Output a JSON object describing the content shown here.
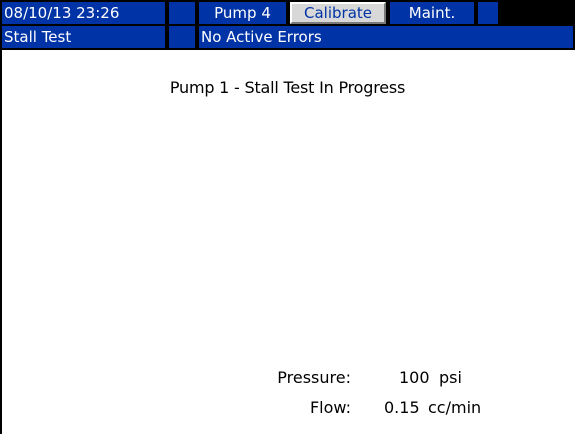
{
  "header": {
    "datetime": "08/10/13 23:26",
    "pump": "Pump 4",
    "tab_calibrate": "Calibrate",
    "tab_maint": "Maint."
  },
  "status": {
    "mode": "Stall Test",
    "errors": "No Active Errors"
  },
  "main": {
    "message": "Pump 1 - Stall Test In Progress",
    "pressure": {
      "label": "Pressure:",
      "value": "100",
      "unit": "psi"
    },
    "flow": {
      "label": "Flow:",
      "value": "0.15",
      "unit": "cc/min"
    }
  },
  "colors": {
    "bar_blue": "#0033a6",
    "bar_black": "#000000",
    "active_tab": "#d8d8d8"
  }
}
